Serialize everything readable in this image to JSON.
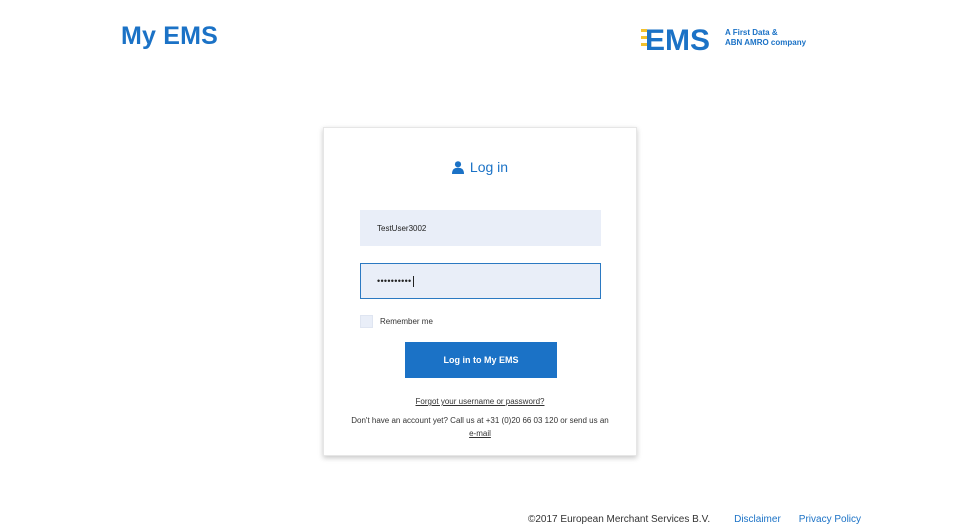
{
  "header": {
    "app_title": "My EMS",
    "brand": {
      "wordmark": "EMS",
      "tagline_line1": "A First Data &",
      "tagline_line2": "ABN AMRO company",
      "color": "#1b72c6",
      "accent_color": "#f2c12e"
    }
  },
  "login_card": {
    "title": "Log in",
    "title_icon": "user-icon",
    "username": {
      "value": "TestUser3002"
    },
    "password": {
      "masked_value": "••••••••••"
    },
    "remember_label": "Remember me",
    "remember_checked": false,
    "submit_label": "Log in to My EMS",
    "forgot_link": "Forgot your username or password?",
    "help_text_prefix": "Don't have an account yet? Call us at +31 (0)20 66 03 120 or send us an ",
    "help_email_link": "e-mail"
  },
  "footer": {
    "copyright": "©2017 European Merchant Services B.V.",
    "disclaimer": "Disclaimer",
    "privacy": "Privacy Policy"
  },
  "colors": {
    "accent": "#1b72c6",
    "field_bg": "#e9eef8",
    "field_focus_border": "#2b79c2"
  }
}
